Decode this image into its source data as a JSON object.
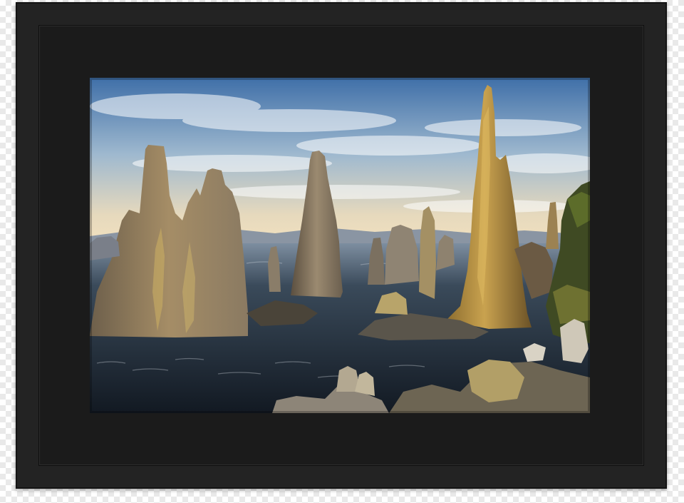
{
  "image": {
    "subject": "tufa-towers-at-lake",
    "colors": {
      "frame": "#232323",
      "mat": "#1b1b1b",
      "sky_top": "#3f6fa8",
      "sky_horizon": "#f3e2bf",
      "water": "#1d2733",
      "tufa_lit": "#c9a24f",
      "tufa_shadow": "#5a4f41"
    }
  }
}
